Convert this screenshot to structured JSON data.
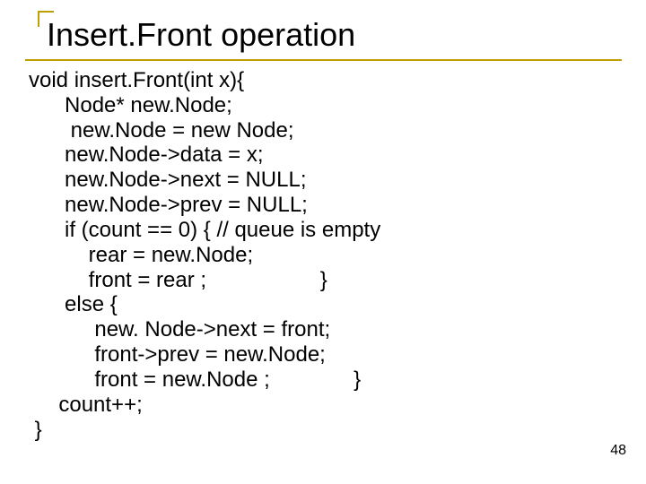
{
  "title": "Insert.Front operation",
  "code": {
    "l1": "void insert.Front(int x){",
    "l2": "      Node* new.Node;",
    "l3": "       new.Node = new Node;",
    "l4": "      new.Node->data = x;",
    "l5": "      new.Node->next = NULL;",
    "l6": "      new.Node->prev = NULL;",
    "l7": "      if (count == 0) { // queue is empty",
    "l8": "          rear = new.Node;",
    "l9": "          front = rear ;                   }",
    "l10": "      else {",
    "l11": "           new. Node->next = front;",
    "l12": "           front->prev = new.Node;",
    "l13": "           front = new.Node ;              }",
    "l14": "     count++;",
    "l15": " }"
  },
  "page_number": "48"
}
